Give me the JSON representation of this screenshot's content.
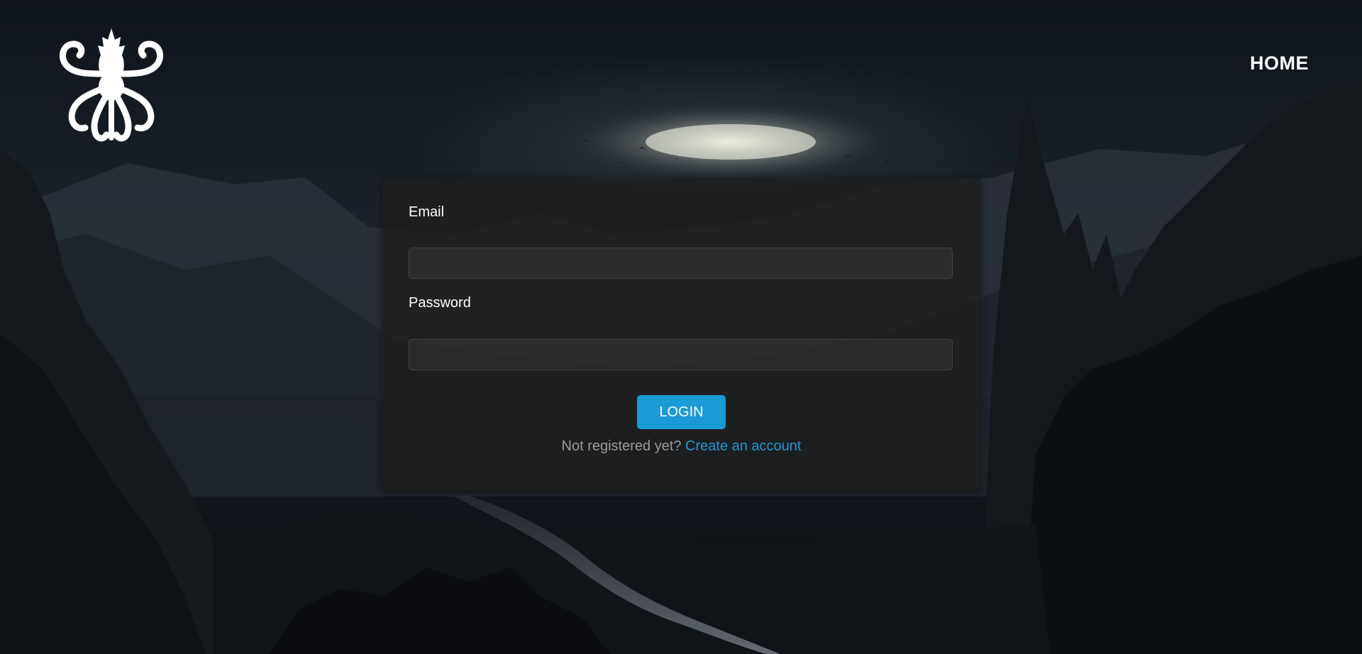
{
  "header": {
    "logo_icon": "kraken-octopus-logo",
    "nav": {
      "home_label": "HOME"
    }
  },
  "login_form": {
    "email_label": "Email",
    "email_value": "",
    "email_placeholder": "",
    "password_label": "Password",
    "password_value": "",
    "password_placeholder": "",
    "submit_label": "LOGIN",
    "register_prompt": "Not registered yet?",
    "register_link_label": "Create an account"
  },
  "colors": {
    "accent": "#1a9ad6",
    "card_background": "#1e1e1e",
    "page_background": "#0d1116",
    "prompt_text": "#9a9a9a"
  }
}
